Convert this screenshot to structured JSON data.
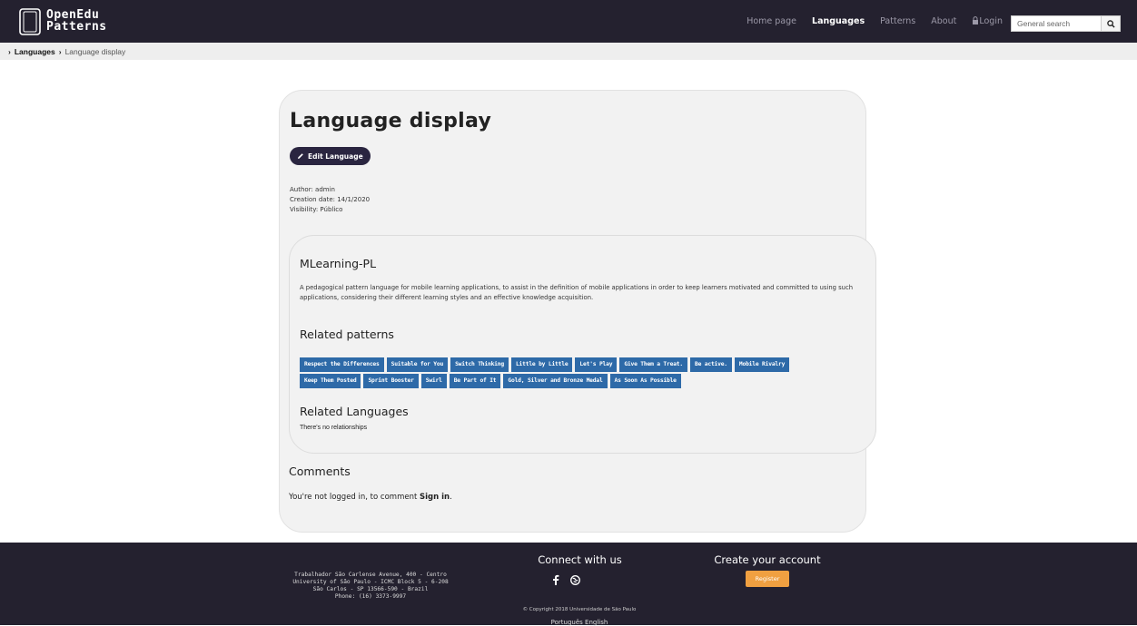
{
  "brand": {
    "line1": "OpenEdu",
    "line2": "Patterns"
  },
  "nav": {
    "items": [
      {
        "label": "Home page",
        "active": false
      },
      {
        "label": "Languages",
        "active": true
      },
      {
        "label": "Patterns",
        "active": false
      },
      {
        "label": "About",
        "active": false
      },
      {
        "label": "Login",
        "active": false,
        "icon": "lock-icon"
      }
    ],
    "search": {
      "placeholder": "General search",
      "icon": "search-icon"
    }
  },
  "breadcrumb": {
    "items": [
      "Languages",
      "Language display"
    ]
  },
  "page": {
    "title": "Language display",
    "edit_button": "Edit Language",
    "edit_icon": "pencil-icon",
    "meta": {
      "author": "Author: admin",
      "creation_date": "Creation date: 14/1/2020",
      "visibility": "Visibility: Público"
    }
  },
  "language": {
    "name": "MLearning-PL",
    "description": "A pedagogical pattern language for mobile learning applications, to assist in the definition of mobile applications in order to keep learners motivated and committed to using such applications, considering their different learning styles and an effective knowledge acquisition.",
    "related_patterns_heading": "Related patterns",
    "related_patterns": [
      "Respect the Differences",
      "Suitable for You",
      "Switch Thinking",
      "Little by Little",
      "Let's Play",
      "Give Them a Treat.",
      "Be active.",
      "Mobile Rivalry",
      "Keep Them Posted",
      "Sprint Booster",
      "Swirl",
      "Be Part of It",
      "Gold, Silver and Bronze Medal",
      "As Soon As Possible"
    ],
    "related_languages_heading": "Related Languages",
    "no_relationships": "There's no relationships"
  },
  "comments": {
    "heading": "Comments",
    "message": "You're not logged in, to comment",
    "signin": "Sign in",
    "period": "."
  },
  "footer": {
    "address": [
      "Trabalhador São Carlense Avenue, 400 - Centro",
      "University of São Paulo - ICMC Block 5 - 6-208",
      "São Carlos - SP 13566-590 - Brazil",
      "Phone: (16) 3373-9997"
    ],
    "connect_heading": "Connect with us",
    "social_icons": [
      "facebook-icon",
      "globe-icon"
    ],
    "copyright": "© Copyright 2018 Universidade de São Paulo",
    "languages": "Português English",
    "create_heading": "Create your account",
    "register": "Register"
  },
  "colors": {
    "navbar": "#24212f",
    "tag": "#2e6aa8",
    "edit_button": "#2a2540",
    "register": "#f0a041",
    "card": "#f2f2f2"
  }
}
